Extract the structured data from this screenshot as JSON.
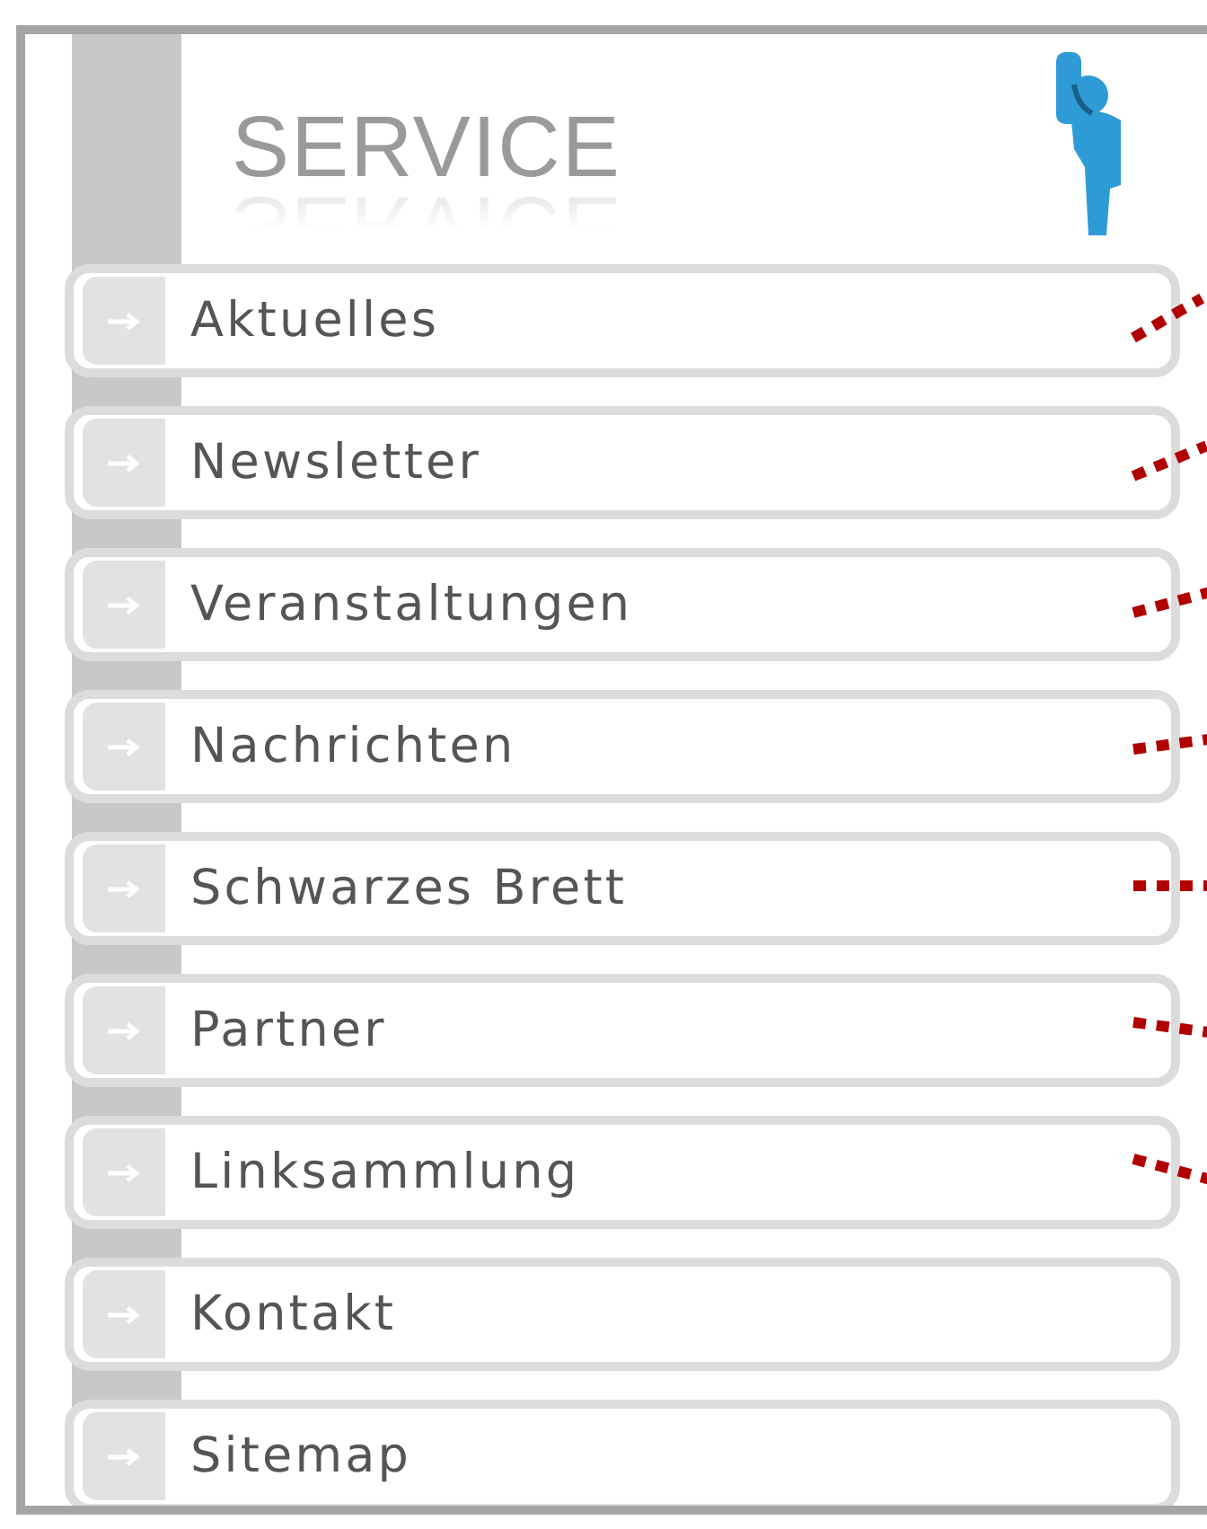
{
  "header": {
    "title": "SERVICE"
  },
  "menu": [
    {
      "label": "Aktuelles",
      "dotted_line": true
    },
    {
      "label": "Newsletter",
      "dotted_line": true
    },
    {
      "label": "Veranstaltungen",
      "dotted_line": true
    },
    {
      "label": "Nachrichten",
      "dotted_line": true
    },
    {
      "label": "Schwarzes Brett",
      "dotted_line": true
    },
    {
      "label": "Partner",
      "dotted_line": true
    },
    {
      "label": "Linksammlung",
      "dotted_line": true
    },
    {
      "label": "Kontakt",
      "dotted_line": false
    },
    {
      "label": "Sitemap",
      "dotted_line": false
    }
  ]
}
